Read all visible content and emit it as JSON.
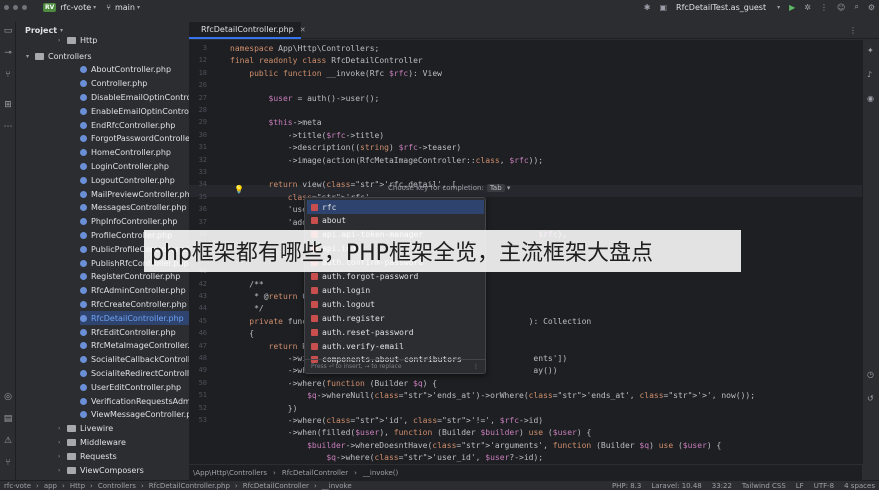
{
  "titlebar": {
    "project_badge": "RV",
    "project_name": "rfc-vote",
    "branch": "main",
    "run_config": "RfcDetailTest.as_guest"
  },
  "project_panel": {
    "title": "Project",
    "items": [
      {
        "label": "Http",
        "type": "folder",
        "indent": 3
      },
      {
        "label": "Controllers",
        "type": "folder",
        "indent": 4,
        "expanded": true
      },
      {
        "label": "AboutController.php",
        "type": "php"
      },
      {
        "label": "Controller.php",
        "type": "php"
      },
      {
        "label": "DisableEmailOptinController.php",
        "type": "php"
      },
      {
        "label": "EnableEmailOptinController.php",
        "type": "php"
      },
      {
        "label": "EndRfcController.php",
        "type": "php"
      },
      {
        "label": "ForgotPasswordController.php",
        "type": "php"
      },
      {
        "label": "HomeController.php",
        "type": "php"
      },
      {
        "label": "LoginController.php",
        "type": "php"
      },
      {
        "label": "LogoutController.php",
        "type": "php"
      },
      {
        "label": "MailPreviewController.php",
        "type": "php"
      },
      {
        "label": "MessagesController.php",
        "type": "php"
      },
      {
        "label": "PhpInfoController.php",
        "type": "php"
      },
      {
        "label": "ProfileController.php",
        "type": "php"
      },
      {
        "label": "PublicProfileController.php",
        "type": "php"
      },
      {
        "label": "PublishRfcController.php",
        "type": "php"
      },
      {
        "label": "RegisterController.php",
        "type": "php"
      },
      {
        "label": "RfcAdminController.php",
        "type": "php"
      },
      {
        "label": "RfcCreateController.php",
        "type": "php"
      },
      {
        "label": "RfcDetailController.php",
        "type": "php",
        "selected": true
      },
      {
        "label": "RfcEditController.php",
        "type": "php"
      },
      {
        "label": "RfcMetaImageController.php",
        "type": "php"
      },
      {
        "label": "SocialiteCallbackController.php",
        "type": "php"
      },
      {
        "label": "SocialiteRedirectController.php",
        "type": "php"
      },
      {
        "label": "UserEditController.php",
        "type": "php"
      },
      {
        "label": "VerificationRequestsAdminController.php",
        "type": "php"
      },
      {
        "label": "ViewMessageController.php",
        "type": "php"
      },
      {
        "label": "Livewire",
        "type": "folder",
        "indent": 3
      },
      {
        "label": "Middleware",
        "type": "folder",
        "indent": 3
      },
      {
        "label": "Requests",
        "type": "folder",
        "indent": 3
      },
      {
        "label": "ViewComposers",
        "type": "folder",
        "indent": 3
      }
    ]
  },
  "editor": {
    "tab_label": "RfcDetailController.php",
    "line_numbers": [
      "3",
      "12",
      "18",
      "26",
      "27",
      "28",
      "29",
      "30",
      "31",
      "32",
      "33",
      "34",
      "35",
      "36",
      "37",
      "38",
      "39",
      "40",
      "41",
      "42",
      "43",
      "44",
      "45",
      "46",
      "47",
      "48",
      "49",
      "50",
      "51",
      "52",
      "53"
    ],
    "lines": [
      "namespace App\\Http\\Controllers;",
      "final readonly class RfcDetailController",
      "    public function __invoke(Rfc $rfc): View",
      "",
      "        $user = auth()->user();",
      "",
      "        $this->meta",
      "            ->title($rfc->title)",
      "            ->description((string) $rfc->teaser)",
      "            ->image(action(RfcMetaImageController::class, $rfc));",
      "",
      "        return view('rfc.detail', [",
      "            'rfc'",
      "            'user",
      "            'addi",
      "                                                                $rfc),",
      "",
      "",
      "",
      "    /**",
      "     * @return Co",
      "     */",
      "    private funct                                             ): Collection",
      "    {",
      "        return Rf",
      "            ->wit                                              ents'])",
      "            ->whe                                              ay())",
      "            ->where(function (Builder $q) {",
      "                $q->whereNull('ends_at')->orWhere('ends_at', '>', now());",
      "            })",
      "            ->where('id', '!=', $rfc->id)",
      "            ->when(filled($user), function (Builder $builder) use ($user) {",
      "                $builder->whereDoesntHave('arguments', function (Builder $q) use ($user) {",
      "                    $q->where('user_id', $user?->id);"
    ]
  },
  "completion": {
    "hint_text": "Choose key for completion:",
    "hint_key": "Tab",
    "items": [
      "rfc",
      "about",
      "api.api-token-manager",
      "api.index",
      "auth.confirm-password",
      "auth.forgot-password",
      "auth.login",
      "auth.logout",
      "auth.register",
      "auth.reset-password",
      "auth.verify-email",
      "components.about-contributors"
    ],
    "footer": "Press ⏎ to insert, → to replace"
  },
  "breadcrumb": [
    "\\App\\Http\\Controllers",
    "RfcDetailController",
    "__invoke()"
  ],
  "statusbar": {
    "crumbs": [
      "rfc-vote",
      "app",
      "Http",
      "Controllers",
      "RfcDetailController.php",
      "RfcDetailController",
      "__invoke"
    ],
    "php": "PHP: 8.3",
    "laravel": "Laravel: 10.48",
    "position": "33:22",
    "tailwind": "Tailwind CSS",
    "line_ending": "LF",
    "encoding": "UTF-8",
    "indent": "4 spaces"
  },
  "banner": {
    "text": "php框架都有哪些，PHP框架全览，主流框架大盘点"
  }
}
